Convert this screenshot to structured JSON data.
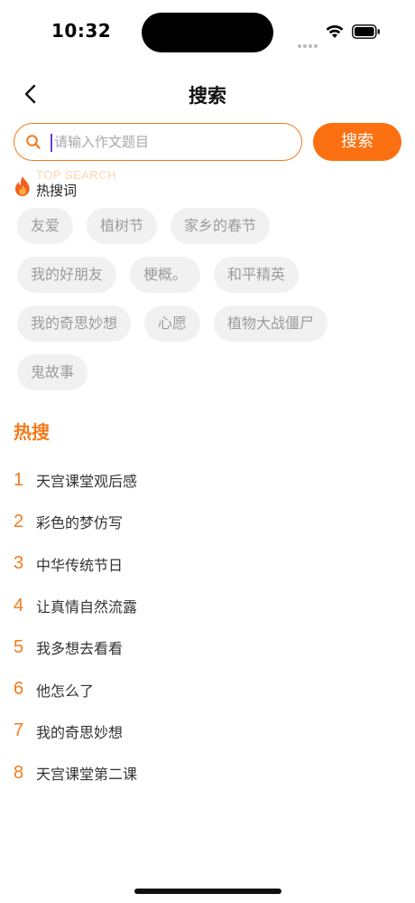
{
  "status_bar": {
    "time": "10:32"
  },
  "nav": {
    "title": "搜索"
  },
  "search": {
    "placeholder": "请输入作文题目",
    "button_label": "搜索"
  },
  "hot_words": {
    "watermark": "TOP SEARCH",
    "label": "热搜词",
    "rows": [
      [
        "友爱",
        "植树节",
        "家乡的春节"
      ],
      [
        "我的好朋友",
        "梗概。",
        "和平精英"
      ],
      [
        "我的奇思妙想",
        "心愿",
        "植物大战僵尸"
      ],
      [
        "鬼故事"
      ]
    ]
  },
  "hot_list": {
    "title": "热搜",
    "items": [
      {
        "rank": "1",
        "text": "天宫课堂观后感"
      },
      {
        "rank": "2",
        "text": "彩色的梦仿写"
      },
      {
        "rank": "3",
        "text": "中华传统节日"
      },
      {
        "rank": "4",
        "text": "让真情自然流露"
      },
      {
        "rank": "5",
        "text": "我多想去看看"
      },
      {
        "rank": "6",
        "text": "他怎么了"
      },
      {
        "rank": "7",
        "text": "我的奇思妙想"
      },
      {
        "rank": "8",
        "text": "天宫课堂第二课"
      }
    ]
  },
  "colors": {
    "accent": "#fb7010",
    "accent_text": "#f47a1b",
    "tag_bg": "#f1f1f1",
    "tag_text": "#9c9c9c"
  },
  "icons": [
    "back-icon",
    "search-icon",
    "fire-icon",
    "wifi-icon",
    "battery-icon",
    "signal-icon"
  ]
}
